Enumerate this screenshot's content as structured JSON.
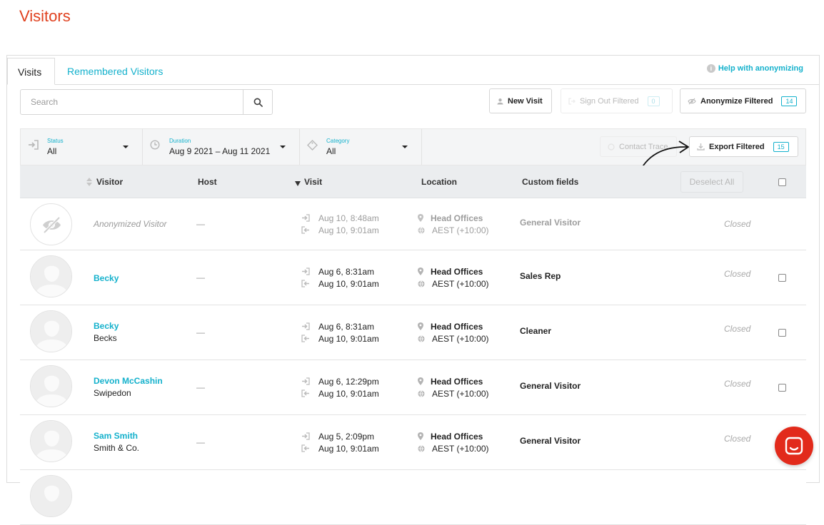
{
  "page": {
    "title": "Visitors"
  },
  "tabs": [
    {
      "label": "Visits",
      "active": true
    },
    {
      "label": "Remembered Visitors",
      "active": false
    }
  ],
  "help": {
    "label": "Help with anonymizing"
  },
  "search": {
    "placeholder": "Search",
    "value": ""
  },
  "toolbar": {
    "new_visit": "New Visit",
    "sign_out_filtered": "Sign Out Filtered",
    "sign_out_count": "0",
    "anonymize_filtered": "Anonymize Filtered",
    "anonymize_count": "14",
    "contact_trace": "Contact Trace",
    "export_filtered": "Export Filtered",
    "export_count": "15"
  },
  "filters": {
    "status": {
      "label": "Status",
      "value": "All"
    },
    "duration": {
      "label": "Duration",
      "value": "Aug 9 2021 – Aug 11 2021"
    },
    "category": {
      "label": "Category",
      "value": "All"
    }
  },
  "table": {
    "headers": {
      "visitor": "Visitor",
      "host": "Host",
      "visit": "Visit",
      "location": "Location",
      "custom_fields": "Custom fields"
    },
    "deselect_all": "Deselect All",
    "rows": [
      {
        "name": "Anonymized Visitor",
        "company": "",
        "host": "—",
        "sign_in": "Aug 10, 8:48am",
        "sign_out": "Aug 10, 9:01am",
        "location": "Head Offices",
        "timezone": "AEST (+10:00)",
        "custom": "General Visitor",
        "status": "Closed",
        "anonymized": true
      },
      {
        "name": "Becky",
        "company": "",
        "host": "—",
        "sign_in": "Aug 6, 8:31am",
        "sign_out": "Aug 10, 9:01am",
        "location": "Head Offices",
        "timezone": "AEST (+10:00)",
        "custom": "Sales Rep",
        "status": "Closed",
        "anonymized": false
      },
      {
        "name": "Becky",
        "company": "Becks",
        "host": "—",
        "sign_in": "Aug 6, 8:31am",
        "sign_out": "Aug 10, 9:01am",
        "location": "Head Offices",
        "timezone": "AEST (+10:00)",
        "custom": "Cleaner",
        "status": "Closed",
        "anonymized": false
      },
      {
        "name": "Devon McCashin",
        "company": "Swipedon",
        "host": "—",
        "sign_in": "Aug 6, 12:29pm",
        "sign_out": "Aug 10, 9:01am",
        "location": "Head Offices",
        "timezone": "AEST (+10:00)",
        "custom": "General Visitor",
        "status": "Closed",
        "anonymized": false
      },
      {
        "name": "Sam Smith",
        "company": "Smith & Co.",
        "host": "—",
        "sign_in": "Aug 5, 2:09pm",
        "sign_out": "Aug 10, 9:01am",
        "location": "Head Offices",
        "timezone": "AEST (+10:00)",
        "custom": "General Visitor",
        "status": "Closed",
        "anonymized": false
      }
    ]
  },
  "colors": {
    "accent": "#14b1cc",
    "title": "#e0411f",
    "chat": "#e22a1b"
  }
}
